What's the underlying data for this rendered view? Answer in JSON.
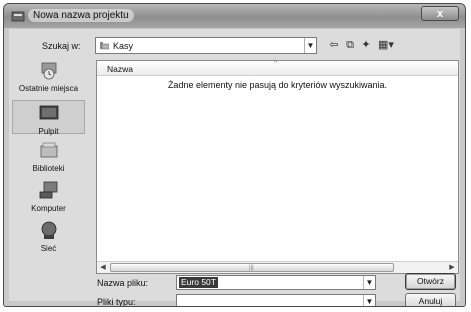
{
  "window": {
    "title": "Nowa nazwa projektu",
    "close_label": "x"
  },
  "lookin": {
    "label": "Szukaj w:",
    "value": "Kasy"
  },
  "toolbar": {
    "back_icon": "⇦",
    "up_icon": "⧉",
    "new_folder_icon": "✦",
    "views_icon": "▦▾"
  },
  "places": [
    {
      "label": "Ostatnie miejsca",
      "icon": "recent-places-icon"
    },
    {
      "label": "Pulpit",
      "icon": "desktop-icon"
    },
    {
      "label": "Biblioteki",
      "icon": "libraries-icon"
    },
    {
      "label": "Komputer",
      "icon": "computer-icon"
    },
    {
      "label": "Sieć",
      "icon": "network-icon"
    }
  ],
  "filelist": {
    "column_name": "Nazwa",
    "empty_message": "Żadne elementy nie pasują do kryteriów wyszukiwania."
  },
  "filename": {
    "label": "Nazwa pliku:",
    "value": "Euro 50T"
  },
  "filetype": {
    "label": "Pliki typu:",
    "value": ""
  },
  "buttons": {
    "open": "Otwórz",
    "cancel": "Anuluj"
  }
}
